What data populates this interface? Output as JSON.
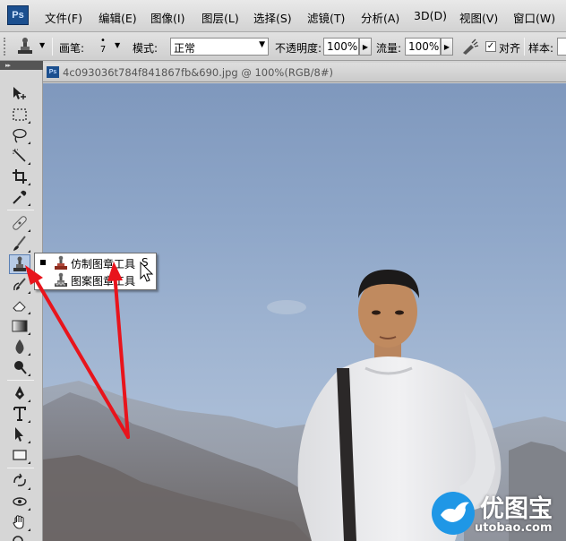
{
  "app": {
    "logo_text": "Ps"
  },
  "menubar": {
    "items": [
      "文件(F)",
      "编辑(E)",
      "图像(I)",
      "图层(L)",
      "选择(S)",
      "滤镜(T)",
      "分析(A)",
      "3D(D)",
      "视图(V)",
      "窗口(W)"
    ]
  },
  "options": {
    "brush_label": "画笔:",
    "brush_size": "7",
    "mode_label": "模式:",
    "mode_value": "正常",
    "opacity_label": "不透明度:",
    "opacity_value": "100%",
    "flow_label": "流量:",
    "flow_value": "100%",
    "aligned_label": "对齐",
    "aligned_checked": true,
    "sample_label": "样本:"
  },
  "document": {
    "icon_text": "Ps",
    "title": "4c093036t784f841867fb&690.jpg @ 100%(RGB/8#)"
  },
  "flyout": {
    "items": [
      {
        "label": "仿制图章工具",
        "shortcut": "S",
        "selected": true
      },
      {
        "label": "图案图章工具",
        "shortcut": "",
        "selected": false
      }
    ]
  },
  "watermark": {
    "text": "优图宝",
    "url": "utobao.com"
  },
  "colors": {
    "annotation_arrow": "#e8141c",
    "active_tool": "#b7cbe6",
    "sky": "#8ea6c8"
  }
}
